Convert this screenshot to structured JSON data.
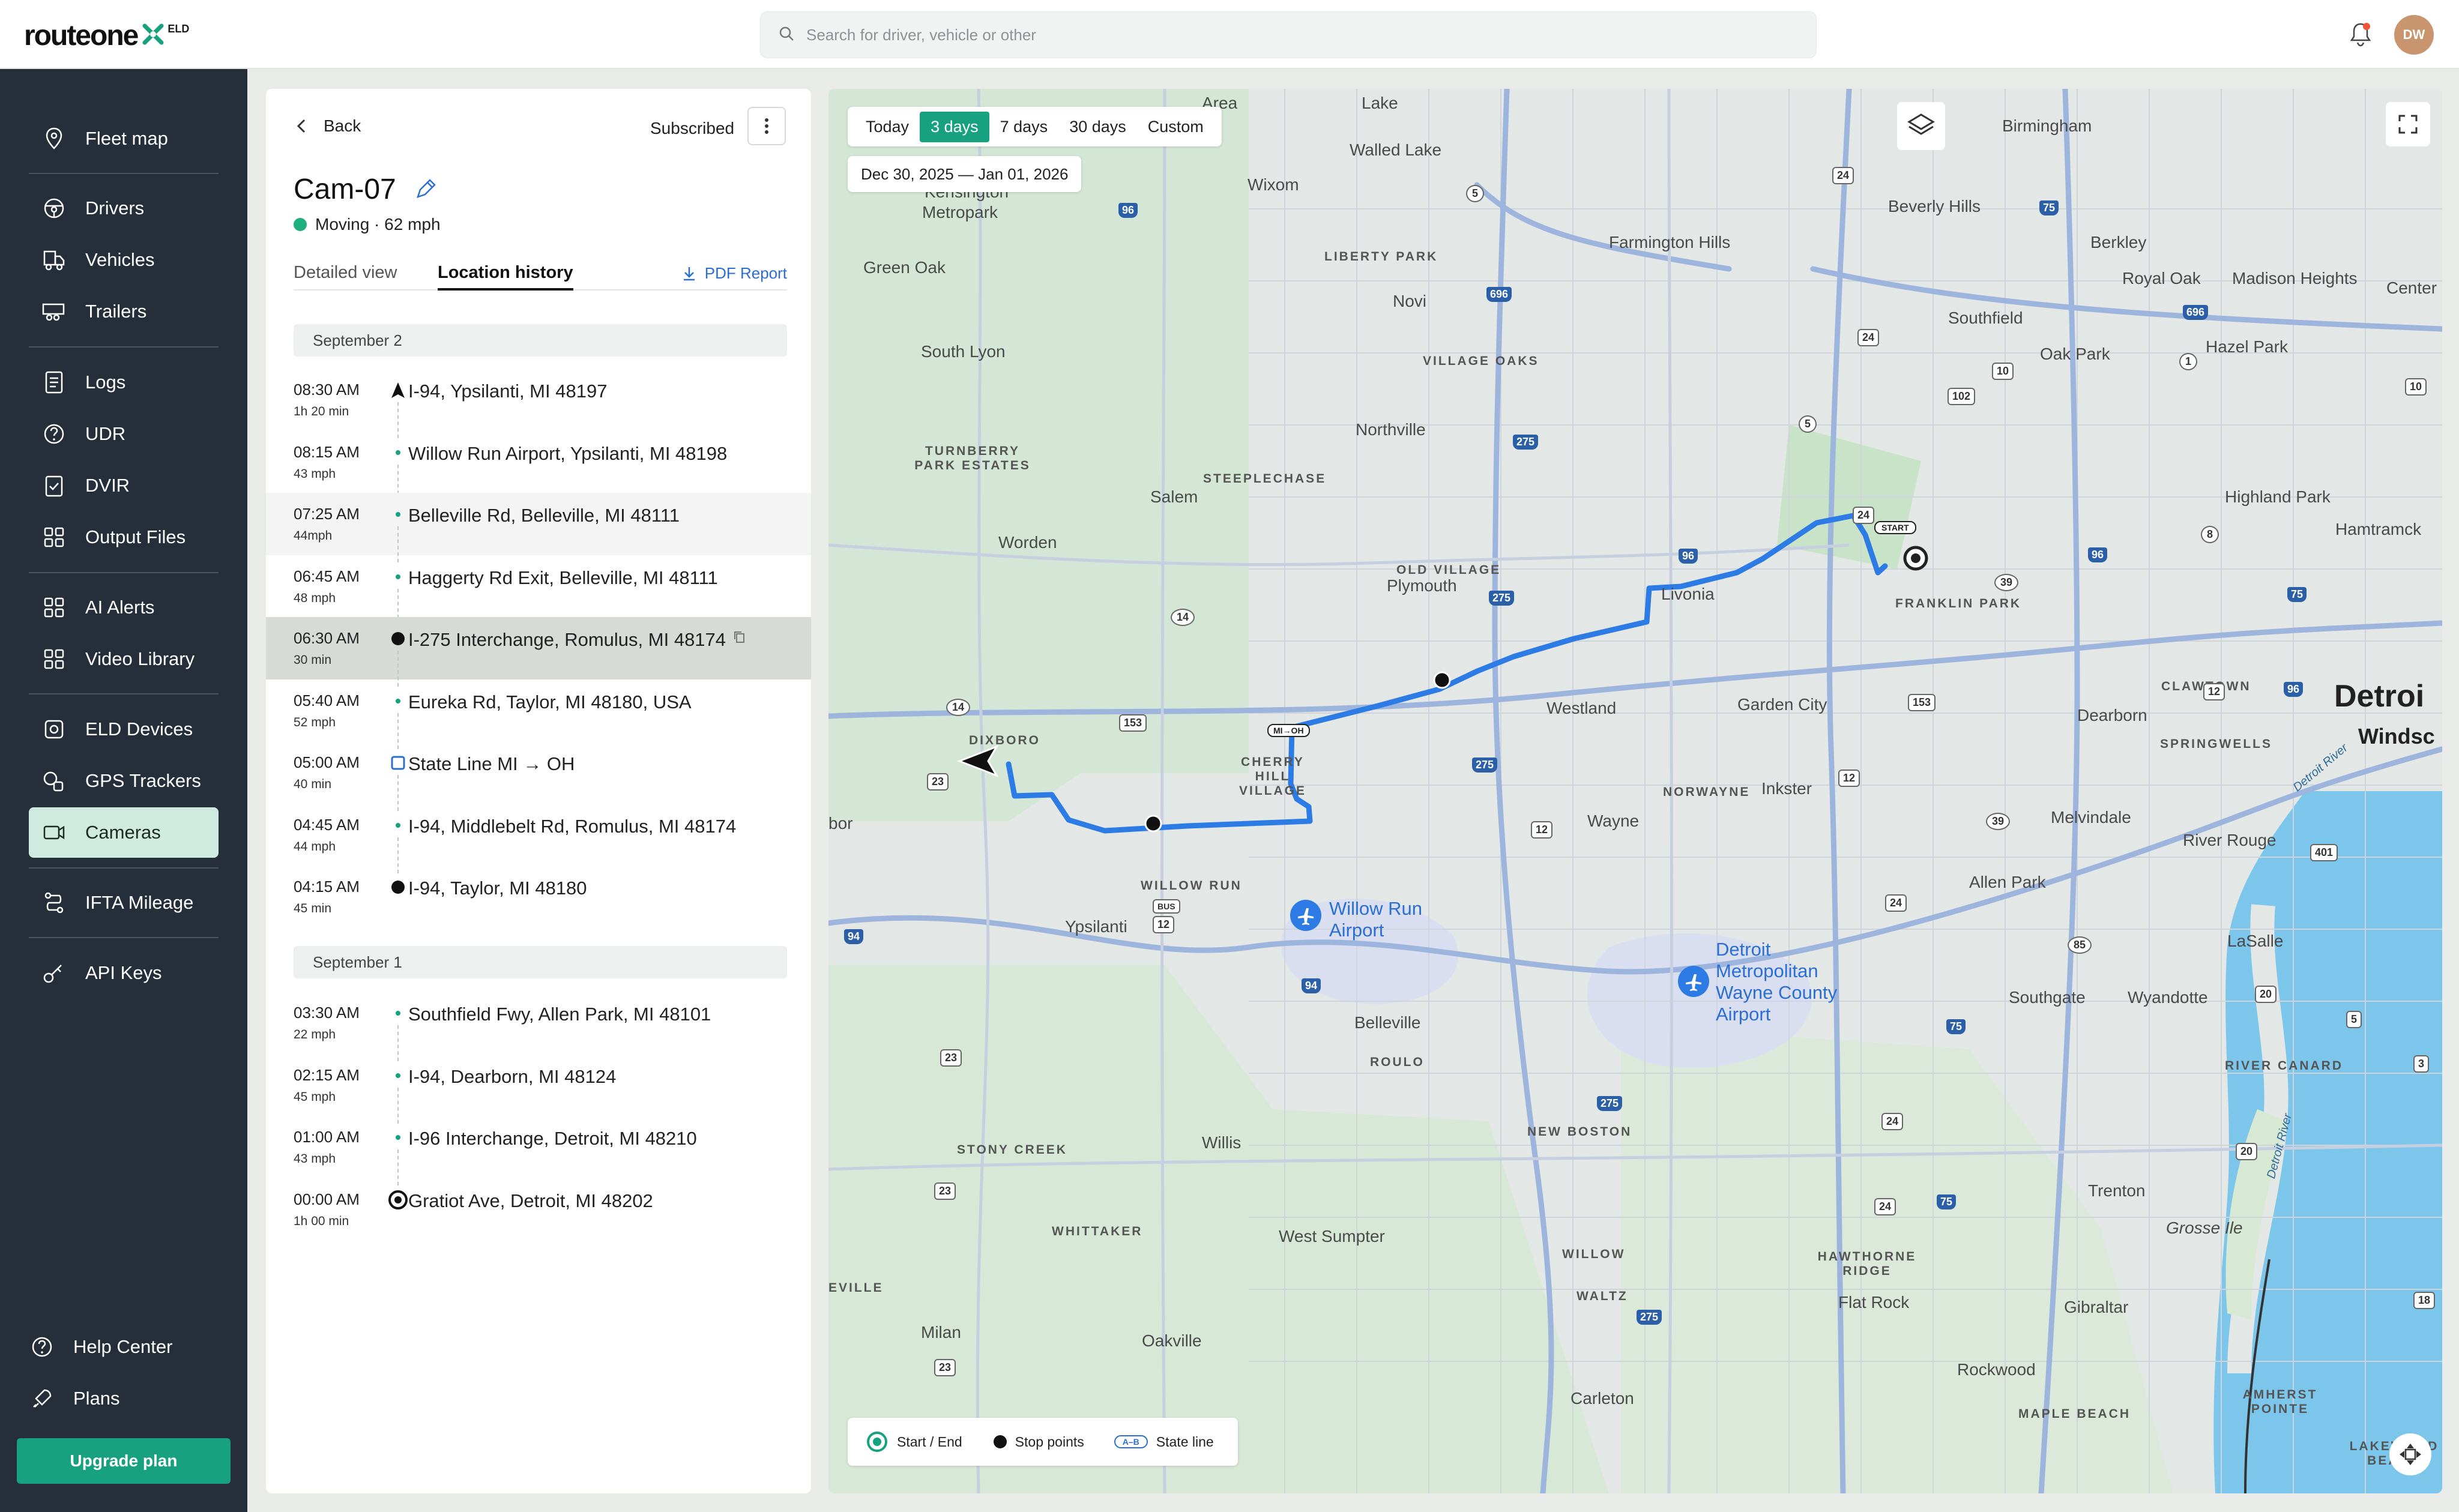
{
  "app": {
    "logo_text": "routeone",
    "logo_badge": "ELD",
    "brand_color": "#17a17f",
    "sidebar_color": "#262e3a",
    "route_color": "#2d7be5"
  },
  "search": {
    "placeholder": "Search for driver, vehicle or other"
  },
  "user": {
    "initials": "DW"
  },
  "nav": {
    "items": [
      {
        "label": "Fleet map",
        "icon": "map-pin-icon"
      },
      {
        "label": "Drivers",
        "icon": "steering-wheel-icon"
      },
      {
        "label": "Vehicles",
        "icon": "truck-icon"
      },
      {
        "label": "Trailers",
        "icon": "trailer-icon"
      },
      {
        "label": "Logs",
        "icon": "document-icon"
      },
      {
        "label": "UDR",
        "icon": "question-circle-icon"
      },
      {
        "label": "DVIR",
        "icon": "clipboard-check-icon"
      },
      {
        "label": "Output Files",
        "icon": "grid-icon"
      },
      {
        "label": "AI Alerts",
        "icon": "grid-icon"
      },
      {
        "label": "Video Library",
        "icon": "grid-icon"
      },
      {
        "label": "ELD Devices",
        "icon": "device-icon"
      },
      {
        "label": "GPS Trackers",
        "icon": "tracker-icon"
      },
      {
        "label": "Cameras",
        "icon": "camera-icon"
      },
      {
        "label": "IFTA Mileage",
        "icon": "route-icon"
      },
      {
        "label": "API Keys",
        "icon": "key-icon"
      }
    ],
    "active": "Cameras",
    "help": "Help Center",
    "plans": "Plans",
    "upgrade": "Upgrade plan"
  },
  "panel": {
    "back": "Back",
    "subscribed": "Subscribed",
    "title": "Cam-07",
    "status": "Moving · 62 mph",
    "tabs": [
      "Detailed view",
      "Location history"
    ],
    "active_tab": "Location history",
    "pdf": "PDF Report",
    "days": [
      {
        "date": "September 2",
        "entries": [
          {
            "time": "08:30 AM",
            "sub": "1h 20 min",
            "addr": "I-94, Ypsilanti, MI 48197",
            "marker": "arrow"
          },
          {
            "time": "08:15 AM",
            "sub": "43 mph",
            "addr": "Willow Run Airport, Ypsilanti, MI 48198",
            "marker": "dot-small"
          },
          {
            "time": "07:25 AM",
            "sub": "44mph",
            "addr": "Belleville Rd, Belleville, MI 48111",
            "marker": "dot-small"
          },
          {
            "time": "06:45 AM",
            "sub": "48 mph",
            "addr": "Haggerty Rd Exit, Belleville, MI 48111",
            "marker": "dot-small"
          },
          {
            "time": "06:30 AM",
            "sub": "30 min",
            "addr": "I-275 Interchange, Romulus, MI 48174",
            "marker": "stop"
          },
          {
            "time": "05:40 AM",
            "sub": "52 mph",
            "addr": "Eureka Rd, Taylor, MI 48180, USA",
            "marker": "dot-small"
          },
          {
            "time": "05:00 AM",
            "sub": "40 min",
            "addr": "State Line MI → OH",
            "marker": "state"
          },
          {
            "time": "04:45 AM",
            "sub": "44 mph",
            "addr": "I-94, Middlebelt Rd, Romulus, MI 48174",
            "marker": "dot-small"
          },
          {
            "time": "04:15 AM",
            "sub": "45 min",
            "addr": "I-94, Taylor, MI 48180",
            "marker": "stop"
          }
        ]
      },
      {
        "date": "September 1",
        "entries": [
          {
            "time": "03:30 AM",
            "sub": "22 mph",
            "addr": "Southfield Fwy, Allen Park, MI 48101",
            "marker": "dot-small"
          },
          {
            "time": "02:15 AM",
            "sub": "45 mph",
            "addr": "I-94, Dearborn, MI 48124",
            "marker": "dot-small"
          },
          {
            "time": "01:00 AM",
            "sub": "43 mph",
            "addr": "I-96 Interchange, Detroit, MI 48210",
            "marker": "dot-small"
          },
          {
            "time": "00:00 AM",
            "sub": "1h 00 min",
            "addr": "Gratiot Ave, Detroit, MI 48202",
            "marker": "start"
          }
        ]
      }
    ]
  },
  "map": {
    "range_options": [
      "Today",
      "3 days",
      "7 days",
      "30 days",
      "Custom"
    ],
    "range_selected": "3 days",
    "date_range": "Dec 30, 2025 — Jan 01, 2026",
    "legend": {
      "start_end": "Start / End",
      "stops": "Stop points",
      "state_line": "State line",
      "state_tag": "A–B"
    },
    "start_tag": "START",
    "state_marker": "MI→OH",
    "places": {
      "area": "Area",
      "lake": "Lake",
      "walled_lake": "Walled Lake",
      "wixom": "Wixom",
      "kensington": "Kensington",
      "metropark": "Metropark",
      "green_oak": "Green Oak",
      "liberty_park": "LIBERTY PARK",
      "novi": "Novi",
      "farmington_hills": "Farmington Hills",
      "birmingham": "Birmingham",
      "beverly_hills": "Beverly Hills",
      "berkley": "Berkley",
      "royal_oak": "Royal Oak",
      "madison_heights": "Madison Heights",
      "center": "Center",
      "southfield": "Southfield",
      "oak_park": "Oak Park",
      "hazel_park": "Hazel Park",
      "south_lyon": "South Lyon",
      "village_oaks": "VILLAGE OAKS",
      "northville": "Northville",
      "turnberry": "TURNBERRY PARK ESTATES",
      "steeplechase": "STEEPLECHASE",
      "salem": "Salem",
      "highland_park": "Highland Park",
      "hamtramck": "Hamtramck",
      "worden": "Worden",
      "old_village": "OLD VILLAGE",
      "plymouth": "Plymouth",
      "livonia": "Livonia",
      "franklin_park": "FRANKLIN PARK",
      "westland": "Westland",
      "garden_city": "Garden City",
      "clawtown": "CLAWTOWN",
      "detroit": "Detroi",
      "dearborn": "Dearborn",
      "windsor": "Windsc",
      "springwells": "SPRINGWELLS",
      "dixboro": "DIXBORO",
      "cherry_hill": "CHERRY HILL VILLAGE",
      "norwayne": "NORWAYNE",
      "inkster": "Inkster",
      "wayne": "Wayne",
      "melvindale": "Melvindale",
      "river_rouge": "River Rouge",
      "arbor": "bor",
      "willow_run": "WILLOW RUN",
      "ypsilanti": "Ypsilanti",
      "willow_run_airport": "Willow Run Airport",
      "allen_park": "Allen Park",
      "lasalle": "LaSalle",
      "dtw": "Detroit Metropolitan Wayne County Airport",
      "belleville": "Belleville",
      "southgate": "Southgate",
      "wyandotte": "Wyandotte",
      "roulo": "ROULO",
      "river_canard": "RIVER CANARD",
      "new_boston": "NEW BOSTON",
      "stony_creek": "STONY CREEK",
      "willis": "Willis",
      "trenton": "Trenton",
      "grosse_ile": "Grosse Ile",
      "whittaker": "WHITTAKER",
      "west_sumpter": "West Sumpter",
      "willow": "WILLOW",
      "hawthorne_ridge": "HAWTHORNE RIDGE",
      "waltz": "WALTZ",
      "flat_rock": "Flat Rock",
      "gibraltar": "Gibraltar",
      "eville": "EVILLE",
      "milan": "Milan",
      "oakville": "Oakville",
      "carleton": "Carleton",
      "rockwood": "Rockwood",
      "amherst_pointe": "AMHERST POINTE",
      "maple_beach": "MAPLE BEACH",
      "lakewood_beach": "LAKEWOOD BEACH",
      "detroit_river": "Detroit River",
      "detroit_river_2": "Detroit River"
    },
    "shields": [
      "96",
      "5",
      "24",
      "75",
      "696",
      "696",
      "24",
      "10",
      "102",
      "1",
      "275",
      "5",
      "24",
      "96",
      "14",
      "275",
      "39",
      "96",
      "8",
      "75",
      "153",
      "275",
      "12",
      "12",
      "12",
      "39",
      "153",
      "23",
      "14",
      "24",
      "401",
      "23",
      "94",
      "12",
      "BUS",
      "94",
      "85",
      "20",
      "5",
      "75",
      "275",
      "24",
      "20",
      "23",
      "24",
      "75",
      "275",
      "23",
      "18",
      "3",
      "96",
      "10"
    ]
  }
}
